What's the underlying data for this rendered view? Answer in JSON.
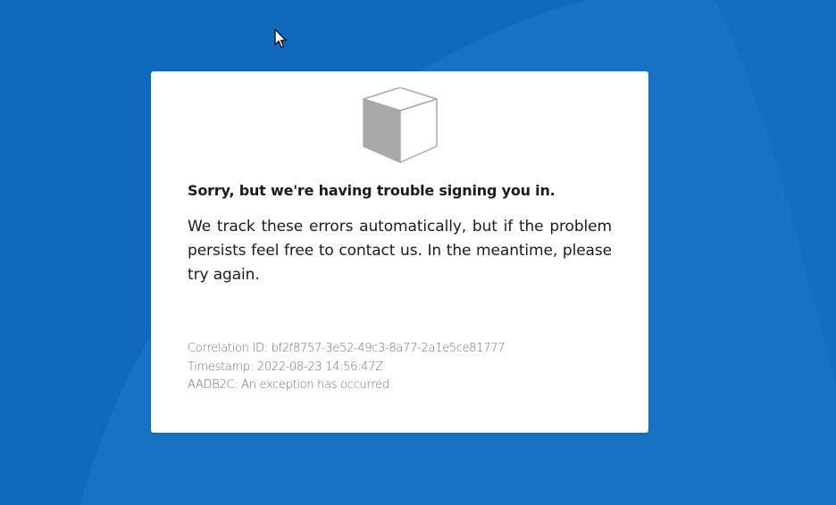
{
  "error": {
    "title": "Sorry, but we're having trouble signing you in.",
    "message": "We track these errors automatically, but if the problem persists feel free to contact us. In the meantime, please try again.",
    "details": {
      "correlation": "Correlation ID: bf2f8757-3e52-49c3-8a77-2a1e5ce81777",
      "timestamp": "Timestamp: 2022-08-23 14:56:47Z",
      "message": "AADB2C: An exception has occurred."
    }
  },
  "icons": {
    "illustration": "cube-icon",
    "pointer": "mouse-cursor-icon"
  },
  "colors": {
    "background": "#1169bd",
    "card": "#ffffff",
    "text": "#1b1b1b",
    "muted_text": "#707070",
    "cube_shade": "#a9a9ab"
  }
}
